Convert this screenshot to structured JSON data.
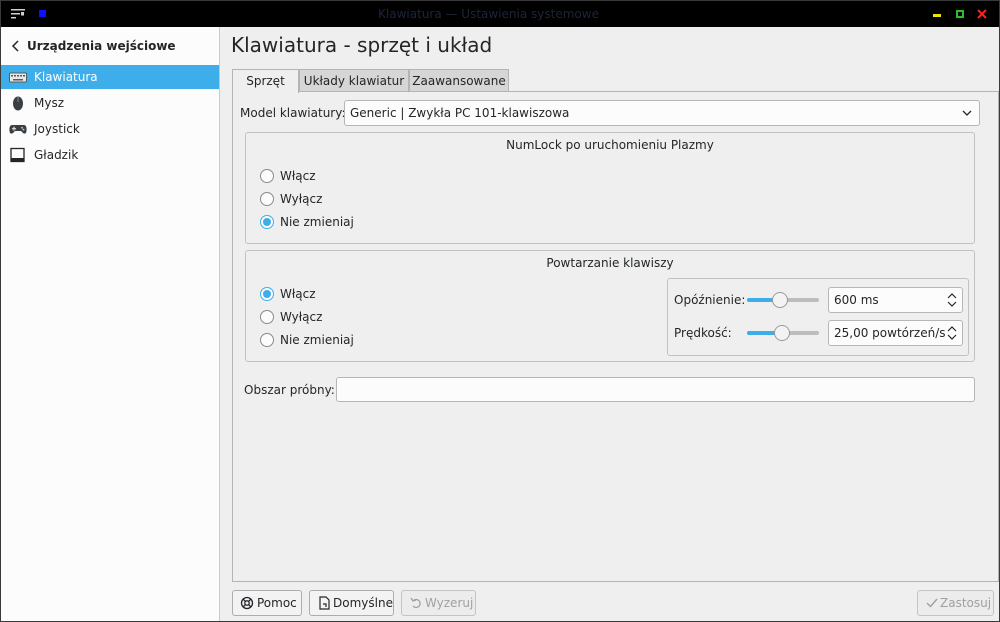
{
  "window": {
    "title": "Klawiatura — Ustawienia systemowe"
  },
  "sidebar": {
    "title": "Urządzenia wejściowe",
    "items": [
      {
        "label": "Klawiatura",
        "icon": "keyboard-icon",
        "active": true
      },
      {
        "label": "Mysz",
        "icon": "mouse-icon",
        "active": false
      },
      {
        "label": "Joystick",
        "icon": "gamepad-icon",
        "active": false
      },
      {
        "label": "Gładzik",
        "icon": "touchpad-icon",
        "active": false
      }
    ]
  },
  "page": {
    "title": "Klawiatura - sprzęt i układ"
  },
  "tabs": [
    {
      "label": "Sprzęt",
      "active": true
    },
    {
      "label": "Układy klawiatur",
      "active": false
    },
    {
      "label": "Zaawansowane",
      "active": false
    }
  ],
  "model": {
    "label": "Model klawiatury:",
    "value": "Generic | Zwykła PC 101-klawiszowa"
  },
  "numlock": {
    "title": "NumLock po uruchomieniu Plazmy",
    "options": [
      "Włącz",
      "Wyłącz",
      "Nie zmieniaj"
    ],
    "selected": 2
  },
  "repeat": {
    "title": "Powtarzanie klawiszy",
    "options": [
      "Włącz",
      "Wyłącz",
      "Nie zmieniaj"
    ],
    "selected": 0,
    "delay": {
      "label": "Opóźnienie:",
      "value": "600 ms",
      "slider_fraction": 0.45
    },
    "rate": {
      "label": "Prędkość:",
      "value": "25,00 powtórzeń/s",
      "slider_fraction": 0.49
    }
  },
  "test_area": {
    "label": "Obszar próbny:",
    "placeholder": ""
  },
  "buttons": {
    "help": "Pomoc",
    "defaults": "Domyślne",
    "reset": "Wyzeruj",
    "apply": "Zastosuj"
  },
  "colors": {
    "accent": "#3daee9",
    "titlebar": "#000000"
  }
}
